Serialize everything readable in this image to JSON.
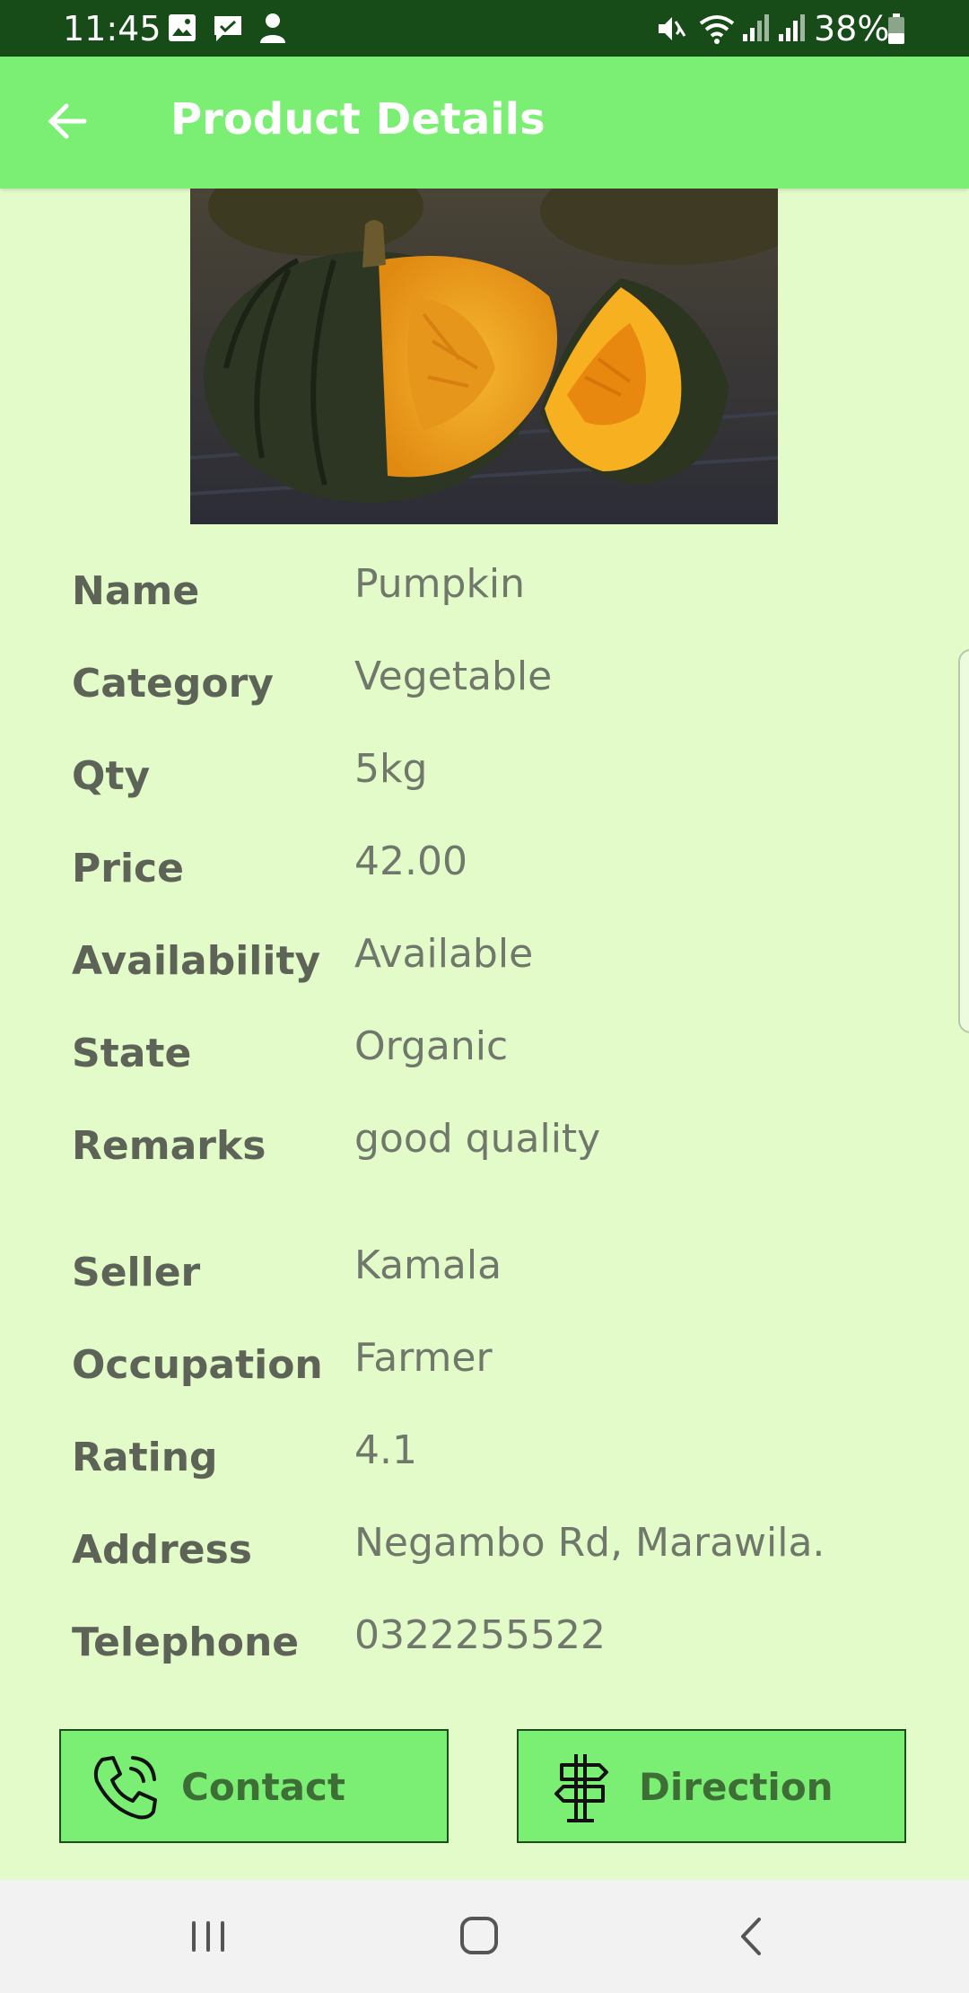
{
  "status_bar": {
    "time": "11:45",
    "battery": "38%",
    "icons": [
      "image-icon",
      "message-icon",
      "person-icon",
      "mute-icon",
      "wifi-icon",
      "signal-icon",
      "signal-icon",
      "battery-icon"
    ]
  },
  "app_bar": {
    "title": "Product Details",
    "back_icon": "arrow-left-icon",
    "background": "#7bef74"
  },
  "product_image": {
    "subject": "pumpkin"
  },
  "details": [
    {
      "label": "Name",
      "value": "Pumpkin"
    },
    {
      "label": "Category",
      "value": "Vegetable"
    },
    {
      "label": "Qty",
      "value": "5kg"
    },
    {
      "label": "Price",
      "value": "42.00"
    },
    {
      "label": "Availability",
      "value": "Available"
    },
    {
      "label": "State",
      "value": "Organic"
    },
    {
      "label": "Remarks",
      "value": "good quality"
    }
  ],
  "seller": [
    {
      "label": "Seller",
      "value": "Kamala"
    },
    {
      "label": "Occupation",
      "value": "Farmer"
    },
    {
      "label": "Rating",
      "value": "4.1"
    },
    {
      "label": "Address",
      "value": "Negambo Rd, Marawila."
    },
    {
      "label": "Telephone",
      "value": "0322255522"
    }
  ],
  "actions": {
    "contact": {
      "label": "Contact",
      "icon": "phone-icon"
    },
    "direction": {
      "label": "Direction",
      "icon": "signpost-icon"
    }
  },
  "nav_bar": {
    "buttons": [
      "recent-apps-icon",
      "home-icon",
      "back-icon"
    ]
  },
  "colors": {
    "page_background": "#e3fbc9",
    "status_bar": "#174c18",
    "accent_green": "#7bef74",
    "button_text": "#3c6e35",
    "label_text": "#5d6357",
    "value_text": "#70776b"
  }
}
